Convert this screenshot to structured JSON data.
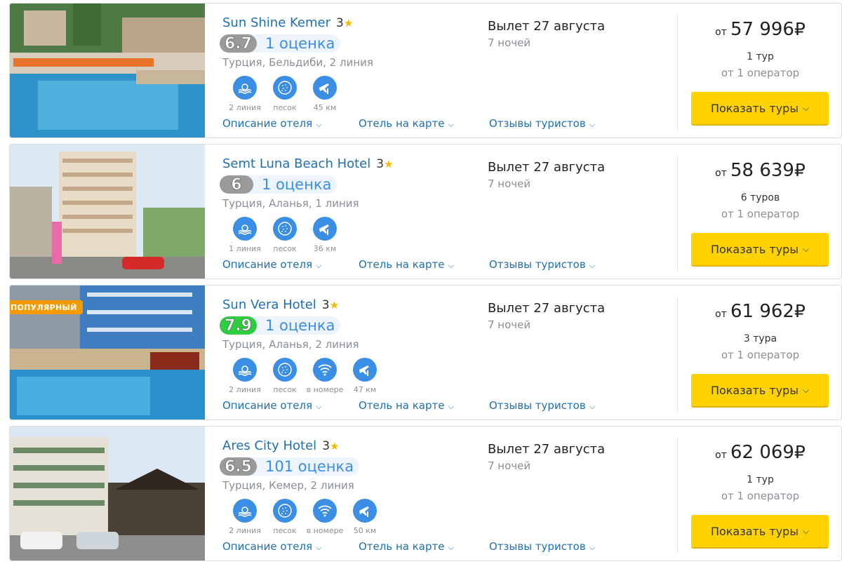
{
  "hotels": [
    {
      "name": "Sun Shine Kemer",
      "stars": "3",
      "score": "6.7",
      "score_color": "grey",
      "reviews": "1 оценка",
      "location": "Турция, Бельдиби, 2 линия",
      "badge": "",
      "amenities": [
        {
          "icon": "beach-line-icon",
          "label": "2 линия"
        },
        {
          "icon": "sand-icon",
          "label": "песок"
        },
        {
          "icon": "airport-distance-icon",
          "label": "45 км"
        }
      ],
      "flight_date": "Вылет 27 августа",
      "nights": "7 ночей",
      "price_from": "от",
      "price": "57 996",
      "currency": "₽",
      "tours": "1 тур",
      "operators": "от 1 оператор",
      "button": "Показать туры"
    },
    {
      "name": "Semt Luna Beach Hotel",
      "stars": "3",
      "score": "6",
      "score_color": "grey",
      "reviews": "1 оценка",
      "location": "Турция, Аланья, 1 линия",
      "badge": "",
      "amenities": [
        {
          "icon": "beach-line-icon",
          "label": "1 линия"
        },
        {
          "icon": "sand-icon",
          "label": "песок"
        },
        {
          "icon": "airport-distance-icon",
          "label": "36 км"
        }
      ],
      "flight_date": "Вылет 27 августа",
      "nights": "7 ночей",
      "price_from": "от",
      "price": "58 639",
      "currency": "₽",
      "tours": "6 туров",
      "operators": "от 1 оператор",
      "button": "Показать туры"
    },
    {
      "name": "Sun Vera Hotel",
      "stars": "3",
      "score": "7.9",
      "score_color": "green",
      "reviews": "1 оценка",
      "location": "Турция, Аланья, 2 линия",
      "badge": "ПОПУЛЯРНЫЙ",
      "amenities": [
        {
          "icon": "beach-line-icon",
          "label": "2 линия"
        },
        {
          "icon": "sand-icon",
          "label": "песок"
        },
        {
          "icon": "wifi-icon",
          "label": "в номере"
        },
        {
          "icon": "airport-distance-icon",
          "label": "47 км"
        }
      ],
      "flight_date": "Вылет 27 августа",
      "nights": "7 ночей",
      "price_from": "от",
      "price": "61 962",
      "currency": "₽",
      "tours": "3 тура",
      "operators": "от 1 оператор",
      "button": "Показать туры"
    },
    {
      "name": "Ares City Hotel",
      "stars": "3",
      "score": "6.5",
      "score_color": "grey",
      "reviews": "101 оценка",
      "location": "Турция, Кемер, 2 линия",
      "badge": "",
      "amenities": [
        {
          "icon": "beach-line-icon",
          "label": "2 линия"
        },
        {
          "icon": "sand-icon",
          "label": "песок"
        },
        {
          "icon": "wifi-icon",
          "label": "в номере"
        },
        {
          "icon": "airport-distance-icon",
          "label": "50 км"
        }
      ],
      "flight_date": "Вылет 27 августа",
      "nights": "7 ночей",
      "price_from": "от",
      "price": "62 069",
      "currency": "₽",
      "tours": "1 тур",
      "operators": "от 1 оператор",
      "button": "Показать туры"
    }
  ],
  "links": {
    "description": "Описание отеля",
    "map": "Отель на карте",
    "reviews": "Отзывы туристов"
  },
  "colors": {
    "link": "#1f6fb3",
    "accent_button": "#ffd200",
    "score_green": "#2ecc40",
    "score_grey": "#9a9a9a",
    "icon_blue": "#3a8ee6",
    "badge_orange": "#f59b00"
  }
}
